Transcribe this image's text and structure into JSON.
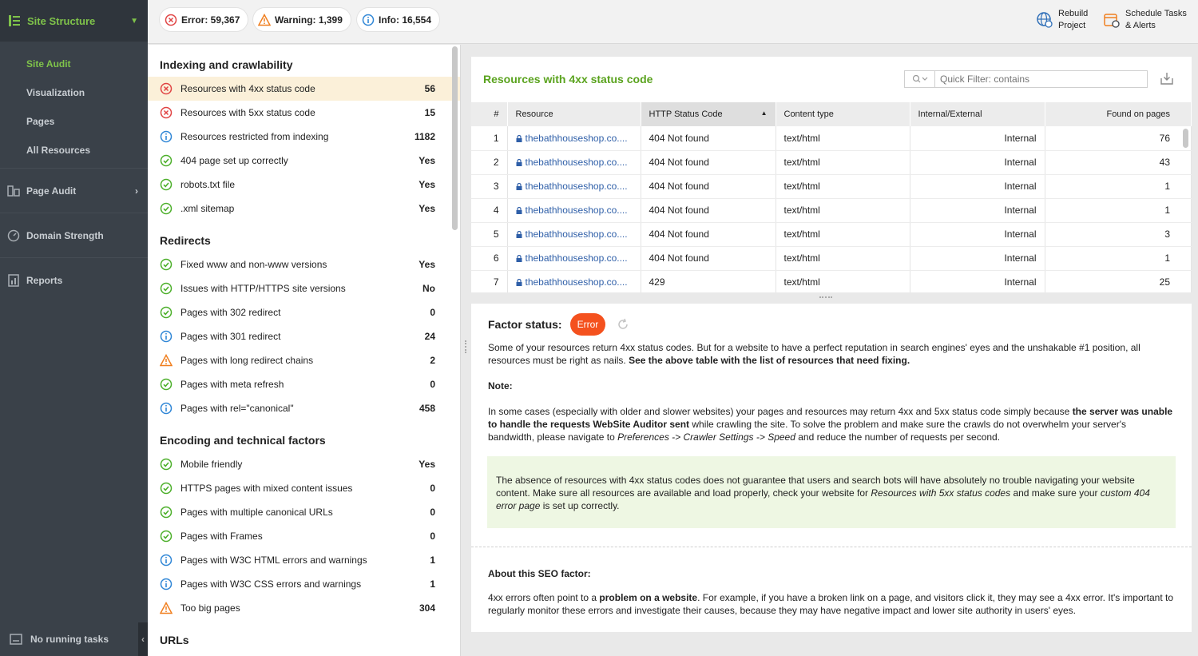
{
  "sidebar": {
    "header": "Site Structure",
    "sub_items": [
      {
        "label": "Site Audit",
        "active": true
      },
      {
        "label": "Visualization",
        "active": false
      },
      {
        "label": "Pages",
        "active": false
      },
      {
        "label": "All Resources",
        "active": false
      }
    ],
    "sections": [
      {
        "label": "Page Audit",
        "icon": "page-audit-icon"
      },
      {
        "label": "Domain Strength",
        "icon": "gauge-icon"
      },
      {
        "label": "Reports",
        "icon": "reports-icon"
      }
    ],
    "footer": "No running tasks"
  },
  "topbar": {
    "error": "Error: 59,367",
    "warning": "Warning: 1,399",
    "info": "Info: 16,554",
    "rebuild_line1": "Rebuild",
    "rebuild_line2": "Project",
    "schedule_line1": "Schedule Tasks",
    "schedule_line2": "& Alerts"
  },
  "groups": [
    {
      "title": "Indexing and crawlability",
      "rows": [
        {
          "status": "error",
          "label": "Resources with 4xx status code",
          "value": "56",
          "selected": true
        },
        {
          "status": "error",
          "label": "Resources with 5xx status code",
          "value": "15"
        },
        {
          "status": "info",
          "label": "Resources restricted from indexing",
          "value": "1182"
        },
        {
          "status": "ok",
          "label": "404 page set up correctly",
          "value": "Yes"
        },
        {
          "status": "ok",
          "label": "robots.txt file",
          "value": "Yes"
        },
        {
          "status": "ok",
          "label": ".xml sitemap",
          "value": "Yes"
        }
      ]
    },
    {
      "title": "Redirects",
      "rows": [
        {
          "status": "ok",
          "label": "Fixed www and non-www versions",
          "value": "Yes"
        },
        {
          "status": "ok",
          "label": "Issues with HTTP/HTTPS site versions",
          "value": "No"
        },
        {
          "status": "ok",
          "label": "Pages with 302 redirect",
          "value": "0"
        },
        {
          "status": "info",
          "label": "Pages with 301 redirect",
          "value": "24"
        },
        {
          "status": "warn",
          "label": "Pages with long redirect chains",
          "value": "2"
        },
        {
          "status": "ok",
          "label": "Pages with meta refresh",
          "value": "0"
        },
        {
          "status": "info",
          "label": "Pages with rel=\"canonical\"",
          "value": "458"
        }
      ]
    },
    {
      "title": "Encoding and technical factors",
      "rows": [
        {
          "status": "ok",
          "label": "Mobile friendly",
          "value": "Yes"
        },
        {
          "status": "ok",
          "label": "HTTPS pages with mixed content issues",
          "value": "0"
        },
        {
          "status": "ok",
          "label": "Pages with multiple canonical URLs",
          "value": "0"
        },
        {
          "status": "ok",
          "label": "Pages with Frames",
          "value": "0"
        },
        {
          "status": "info",
          "label": "Pages with W3C HTML errors and warnings",
          "value": "1"
        },
        {
          "status": "info",
          "label": "Pages with W3C CSS errors and warnings",
          "value": "1"
        },
        {
          "status": "warn",
          "label": "Too big pages",
          "value": "304"
        }
      ]
    },
    {
      "title": "URLs",
      "rows": []
    }
  ],
  "resources": {
    "title": "Resources with 4xx status code",
    "filter_placeholder": "Quick Filter: contains",
    "columns": [
      "#",
      "Resource",
      "HTTP Status Code",
      "Content type",
      "Internal/External",
      "Found on pages"
    ],
    "rows": [
      {
        "n": "1",
        "resource": "thebathhouseshop.co....",
        "status": "404 Not found",
        "type": "text/html",
        "scope": "Internal",
        "found": "76"
      },
      {
        "n": "2",
        "resource": "thebathhouseshop.co....",
        "status": "404 Not found",
        "type": "text/html",
        "scope": "Internal",
        "found": "43"
      },
      {
        "n": "3",
        "resource": "thebathhouseshop.co....",
        "status": "404 Not found",
        "type": "text/html",
        "scope": "Internal",
        "found": "1"
      },
      {
        "n": "4",
        "resource": "thebathhouseshop.co....",
        "status": "404 Not found",
        "type": "text/html",
        "scope": "Internal",
        "found": "1"
      },
      {
        "n": "5",
        "resource": "thebathhouseshop.co....",
        "status": "404 Not found",
        "type": "text/html",
        "scope": "Internal",
        "found": "3"
      },
      {
        "n": "6",
        "resource": "thebathhouseshop.co....",
        "status": "404 Not found",
        "type": "text/html",
        "scope": "Internal",
        "found": "1"
      },
      {
        "n": "7",
        "resource": "thebathhouseshop.co....",
        "status": "429",
        "type": "text/html",
        "scope": "Internal",
        "found": "25"
      }
    ]
  },
  "factor": {
    "label": "Factor status:",
    "badge": "Error",
    "p1_a": "Some of your resources return 4xx status codes. But for a website to have a perfect reputation in search engines' eyes and the unshakable #1 position, all resources must be right as nails. ",
    "p1_b": "See the above table with the list of resources that need fixing.",
    "note": "Note:",
    "p2_a": "In some cases (especially with older and slower websites) your pages and resources may return 4xx and 5xx status code simply because ",
    "p2_b": "the server was unable to handle the requests WebSite Auditor sent",
    "p2_c": " while crawling the site. To solve the problem and make sure the crawls do not overwhelm your server's bandwidth, please navigate to ",
    "p2_d": "Preferences -> Crawler Settings -> Speed",
    "p2_e": " and reduce the number of requests per second.",
    "g_a": "The absence of resources with 4xx status codes does not guarantee that users and search bots will have absolutely no trouble navigating your website content. Make sure all resources are available and load properly, check your website for ",
    "g_b": "Resources with 5xx status codes",
    "g_c": " and make sure your ",
    "g_d": "custom 404 error page",
    "g_e": " is set up correctly.",
    "about": "About this SEO factor:",
    "p3_a": "4xx errors often point to a ",
    "p3_b": "problem on a website",
    "p3_c": ". For example, if you have a broken link on a page, and visitors click it, they may see a 4xx error. It's important to regularly monitor these errors and investigate their causes, because they may have negative impact and lower site authority in users' eyes."
  },
  "colors": {
    "ok": "#4caf2a",
    "error": "#e04343",
    "info": "#2f86d6",
    "warn": "#f07f1f",
    "brand": "#5aa31e"
  }
}
